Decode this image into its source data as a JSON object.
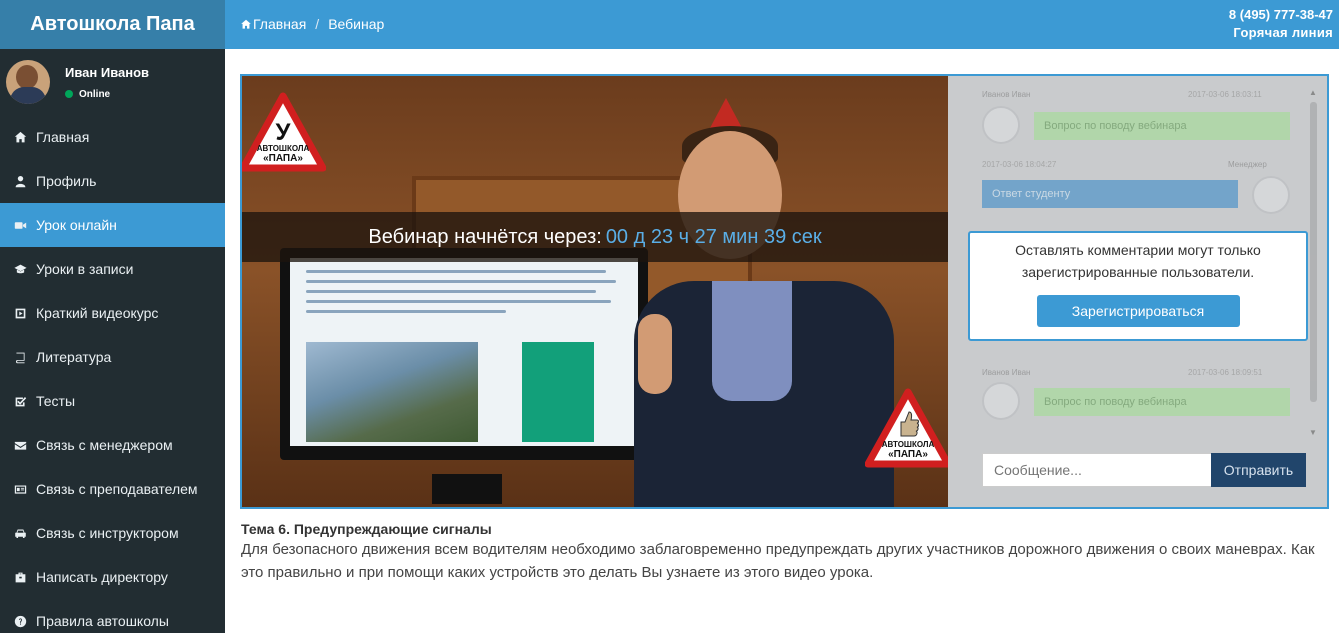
{
  "brand": {
    "title": "Автошкола Папа"
  },
  "user": {
    "name": "Иван Иванов",
    "status": "Online"
  },
  "sidebar": {
    "items": [
      {
        "label": "Главная",
        "icon": "home-icon"
      },
      {
        "label": "Профиль",
        "icon": "user-icon"
      },
      {
        "label": "Урок онлайн",
        "icon": "video-camera-icon",
        "active": true
      },
      {
        "label": "Уроки в записи",
        "icon": "graduation-cap-icon"
      },
      {
        "label": "Краткий видеокурс",
        "icon": "play-square-icon"
      },
      {
        "label": "Литература",
        "icon": "book-icon"
      },
      {
        "label": "Тесты",
        "icon": "checkbox-icon"
      },
      {
        "label": "Связь с менеджером",
        "icon": "envelope-icon"
      },
      {
        "label": "Связь с преподавателем",
        "icon": "id-card-icon"
      },
      {
        "label": "Связь с инструктором",
        "icon": "car-icon"
      },
      {
        "label": "Написать директору",
        "icon": "briefcase-icon"
      },
      {
        "label": "Правила автошколы",
        "icon": "question-circle-icon"
      }
    ]
  },
  "header": {
    "breadcrumb": {
      "home": "Главная",
      "separator": "/",
      "current": "Вебинар"
    },
    "hotline": {
      "phone": "8 (495) 777-38-47",
      "label": "Горячая линия"
    }
  },
  "video": {
    "countdown_label": "Вебинар начнётся через:",
    "countdown_value": "00 д 23 ч 27 мин 39 сек",
    "sign_letter": "У",
    "sign_line1": "АВТОШКОЛА",
    "sign_line2": "«ПАПА»"
  },
  "chat": {
    "messages": [
      {
        "name": "Иванов Иван",
        "time": "2017-03-06 18:03:11",
        "text": "Вопрос по поводу вебинара",
        "side": "in"
      },
      {
        "name": "Менеджер",
        "time": "2017-03-06 18:04:27",
        "text": "Ответ студенту",
        "side": "out"
      },
      {
        "name": "Иванов Иван",
        "time": "2017-03-06 18:09:51",
        "text": "Вопрос по поводу вебинара",
        "side": "in"
      }
    ],
    "notice": "Оставлять комментарии могут только зарегистрированные пользователи.",
    "register_label": "Зарегистрироваться",
    "input_placeholder": "Сообщение...",
    "send_label": "Отправить"
  },
  "lesson": {
    "title": "Тема 6. Предупреждающие сигналы",
    "description": "Для безопасного движения всем водителям необходимо заблаговременно предупреждать других участников дорожного движения о своих маневрах. Как это правильно и при помощи каких устройств это делать Вы узнаете из этого видео урока."
  },
  "colors": {
    "accent": "#3c9ad4",
    "brand_bar": "#367fa9",
    "sidebar_bg": "#222d32",
    "online": "#00a65a"
  }
}
